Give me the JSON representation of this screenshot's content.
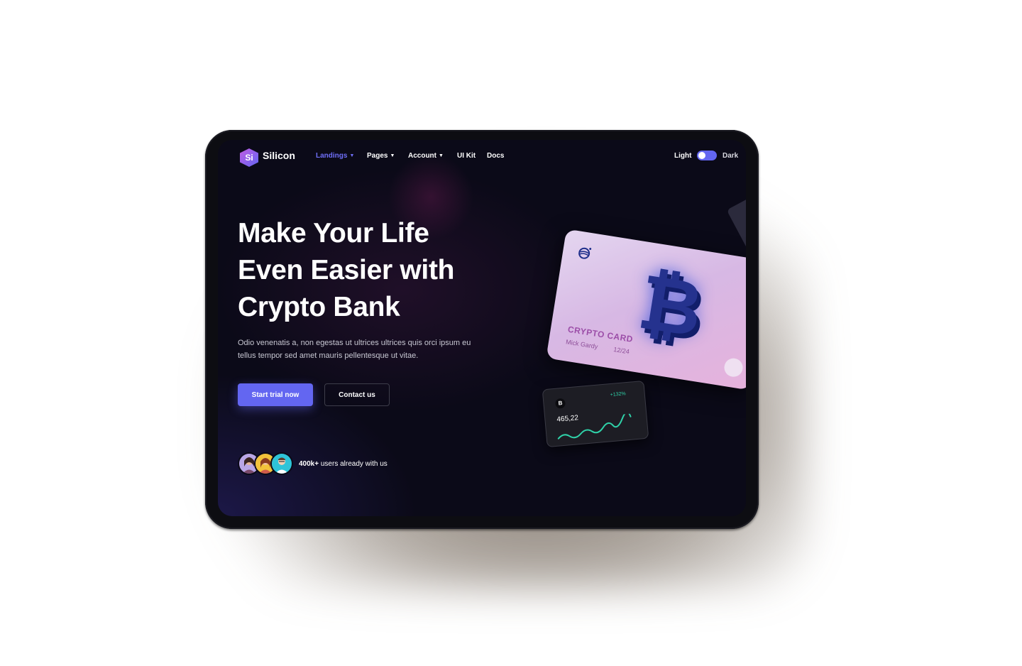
{
  "nav": {
    "brand_badge": "Si",
    "brand": "Silicon",
    "items": [
      {
        "label": "Landings",
        "has_dropdown": true,
        "active": true
      },
      {
        "label": "Pages",
        "has_dropdown": true,
        "active": false
      },
      {
        "label": "Account",
        "has_dropdown": true,
        "active": false
      },
      {
        "label": "UI Kit",
        "has_dropdown": false,
        "active": false
      },
      {
        "label": "Docs",
        "has_dropdown": false,
        "active": false
      }
    ],
    "mode": {
      "light_label": "Light",
      "dark_label": "Dark",
      "dark_enabled": true
    }
  },
  "hero": {
    "title_lines": [
      "Make Your Life",
      "Even Easier with",
      "Crypto Bank"
    ],
    "description": "Odio venenatis a, non egestas ut ultrices ultrices quis orci ipsum eu tellus tempor sed amet mauris pellentesque ut vitae.",
    "primary_button": "Start trial now",
    "secondary_button": "Contact us",
    "users_count": "400k+",
    "users_text": " users already with us"
  },
  "card": {
    "symbol": "₿",
    "label": "CRYPTO CARD",
    "holder": "Mick Gardy",
    "expiry": "12/24"
  },
  "mini_card": {
    "badge": "B",
    "change": "+132%",
    "value": "465,22"
  },
  "colors": {
    "accent": "#6366f1",
    "background": "#0b0a18",
    "positive": "#2fd1a8"
  }
}
